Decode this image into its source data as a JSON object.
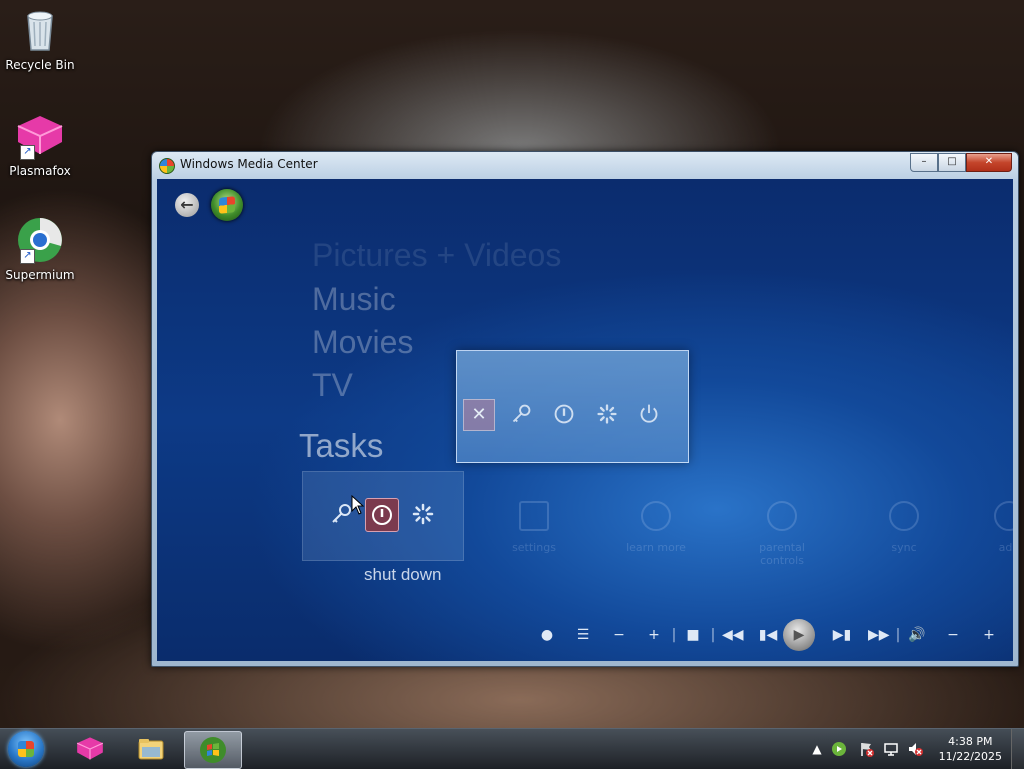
{
  "desktop": {
    "icons": [
      {
        "label": "Recycle Bin",
        "icon": "recycle-bin-icon"
      },
      {
        "label": "Plasmafox",
        "icon": "plasmafox-icon"
      },
      {
        "label": "Supermium",
        "icon": "supermium-icon"
      }
    ]
  },
  "window": {
    "title": "Windows Media Center",
    "controls": {
      "minimize": "–",
      "maximize": "□",
      "close": "✕"
    }
  },
  "wmc": {
    "menu": [
      "Pictures + Videos",
      "Music",
      "Movies",
      "TV"
    ],
    "tasks_label": "Tasks",
    "task_strip_caption": "shut down",
    "background_tiles": [
      "settings",
      "learn more",
      "sync",
      "add"
    ],
    "background_tile_partial": "add",
    "background_tile_mid": "parental controls",
    "dialog_buttons": [
      "close",
      "log off",
      "shut down",
      "restart",
      "sleep"
    ],
    "transport": [
      "record",
      "guide",
      "volume-down",
      "volume-up",
      "stop",
      "rewind",
      "previous",
      "play",
      "next",
      "fast-forward",
      "mute",
      "minus",
      "plus"
    ]
  },
  "taskbar": {
    "pinned": [
      "plasmafox-icon",
      "file-explorer-icon",
      "windows-media-center-icon"
    ],
    "clock_time": "4:38 PM",
    "clock_date": "11/22/2025"
  },
  "colors": {
    "wmc_blue": "#0d3a86",
    "selected_task": "#7b3a4e",
    "close_button": "#c4452b"
  }
}
